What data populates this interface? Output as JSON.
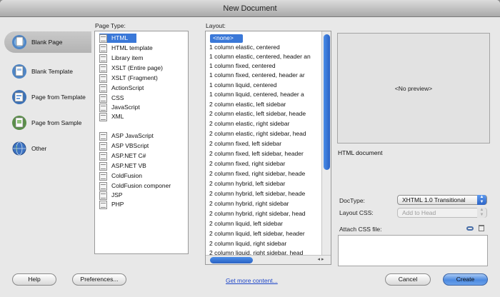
{
  "window": {
    "title": "New Document"
  },
  "categories": [
    {
      "label": "Blank Page",
      "icon": "blank-page-icon",
      "selected": true
    },
    {
      "label": "Blank Template",
      "icon": "blank-template-icon"
    },
    {
      "label": "Page from Template",
      "icon": "page-from-template-icon"
    },
    {
      "label": "Page from Sample",
      "icon": "page-from-sample-icon"
    },
    {
      "label": "Other",
      "icon": "globe-icon"
    }
  ],
  "page_type": {
    "label": "Page Type:",
    "items": [
      "HTML",
      "HTML template",
      "Library item",
      "XSLT (Entire page)",
      "XSLT (Fragment)",
      "ActionScript",
      "CSS",
      "JavaScript",
      "XML",
      "ASP JavaScript",
      "ASP VBScript",
      "ASP.NET C#",
      "ASP.NET VB",
      "ColdFusion",
      "ColdFusion componer",
      "JSP",
      "PHP"
    ],
    "selected": "HTML"
  },
  "layout": {
    "label": "Layout:",
    "items": [
      "<none>",
      "1 column elastic, centered",
      "1 column elastic, centered, header an",
      "1 column fixed, centered",
      "1 column fixed, centered, header ar",
      "1 column liquid, centered",
      "1 column liquid, centered, header a",
      "2 column elastic, left sidebar",
      "2 column elastic, left sidebar, heade",
      "2 column elastic, right sidebar",
      "2 column elastic, right sidebar, head",
      "2 column fixed, left sidebar",
      "2 column fixed, left sidebar, header",
      "2 column fixed, right sidebar",
      "2 column fixed, right sidebar, heade",
      "2 column hybrid, left sidebar",
      "2 column hybrid, left sidebar, heade",
      "2 column hybrid, right sidebar",
      "2 column hybrid, right sidebar, head",
      "2 column liquid, left sidebar",
      "2 column liquid, left sidebar, header",
      "2 column liquid, right sidebar",
      "2 column liquid, right sidebar, head"
    ],
    "selected": "<none>"
  },
  "preview": {
    "text": "<No preview>"
  },
  "description": "HTML document",
  "doctype": {
    "label": "DocType:",
    "value": "XHTML 1.0 Transitional"
  },
  "layout_css": {
    "label": "Layout CSS:",
    "value": "Add to Head"
  },
  "attach_css": {
    "label": "Attach CSS file:"
  },
  "buttons": {
    "help": "Help",
    "preferences": "Preferences...",
    "more_content": "Get more content...",
    "cancel": "Cancel",
    "create": "Create"
  },
  "colors": {
    "accent": "#3a78d8",
    "link": "#1e46c8"
  }
}
